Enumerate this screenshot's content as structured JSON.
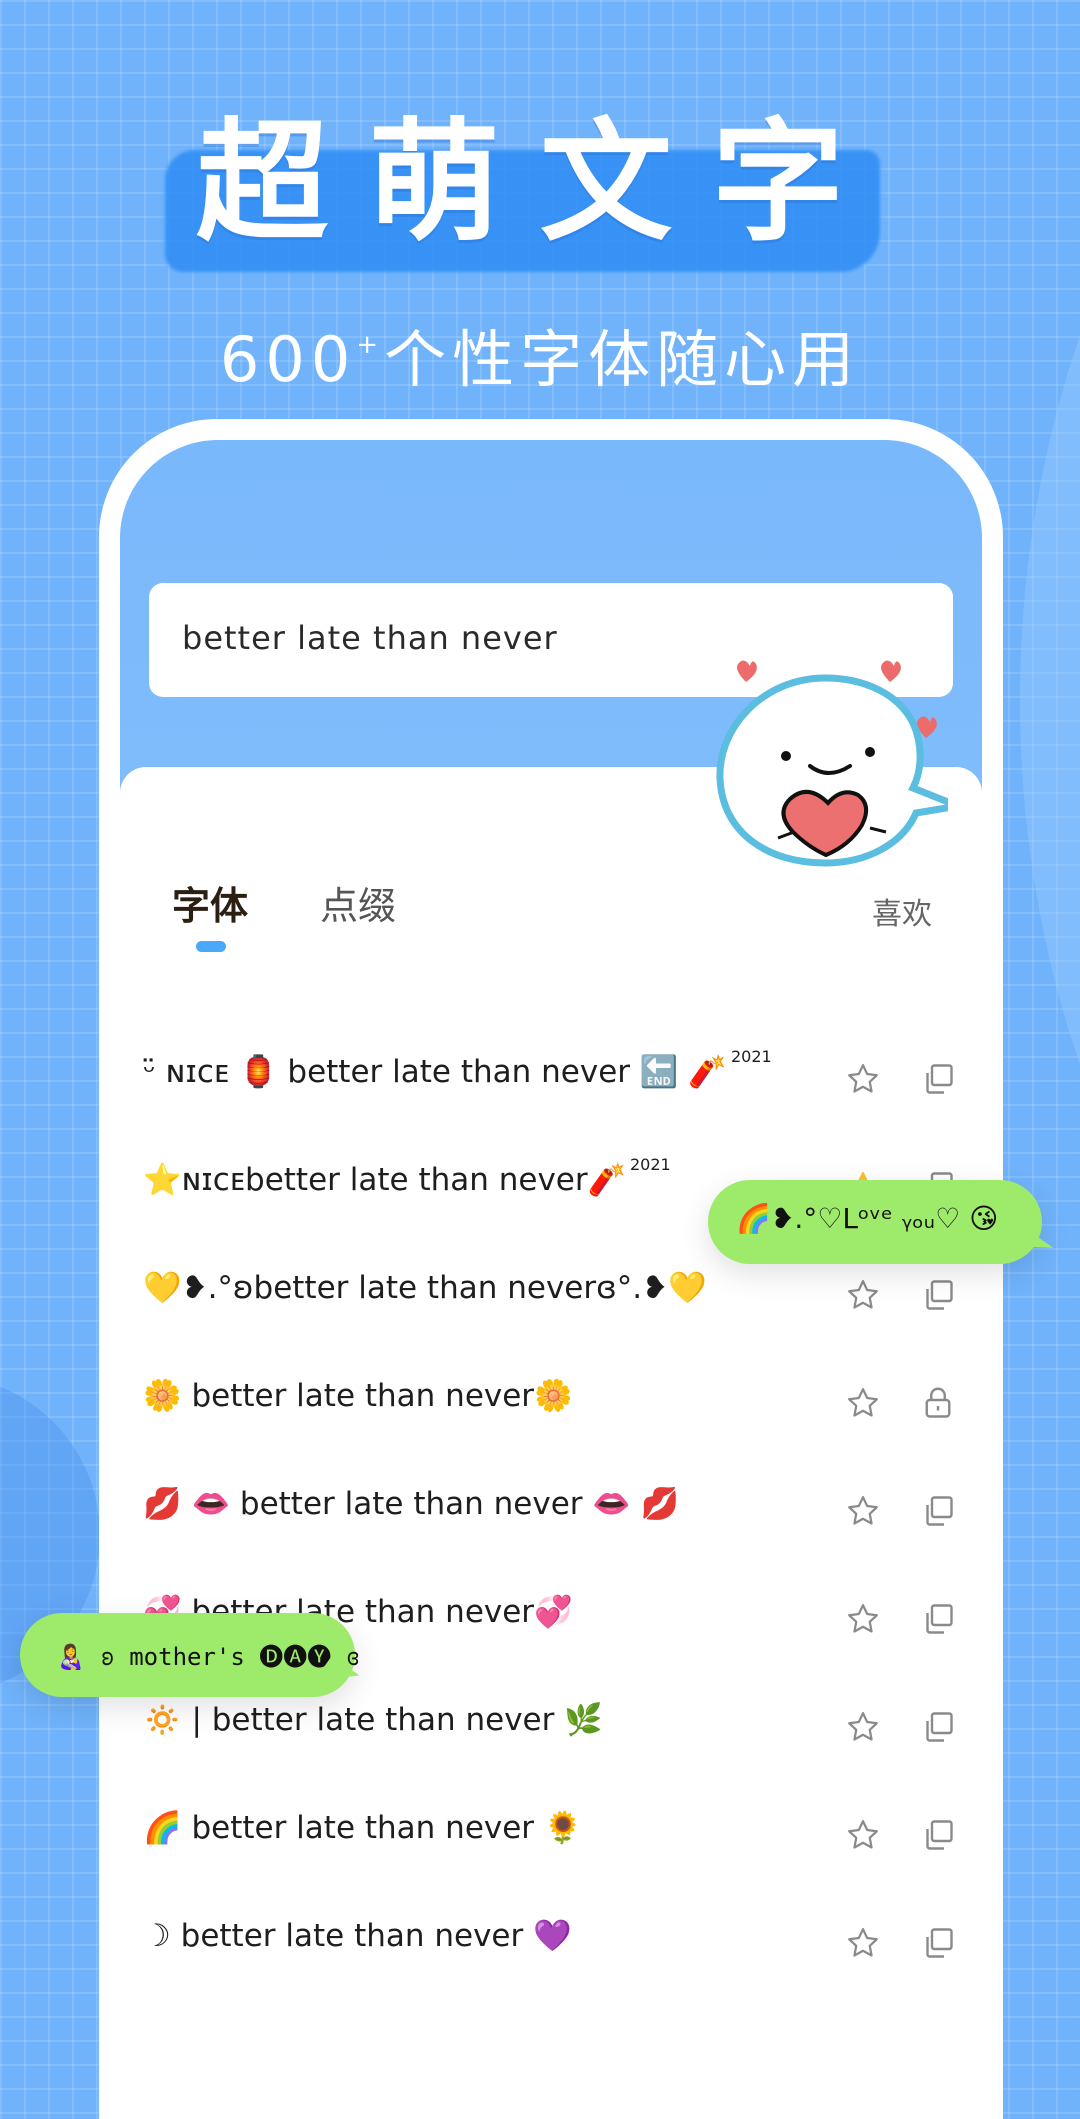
{
  "banner": {
    "title": "超萌文字",
    "subtitle_count": "600",
    "subtitle_plus": "+",
    "subtitle_text": "个性字体随心用"
  },
  "search": {
    "value": "better late than never"
  },
  "tabs": [
    {
      "label": "字体",
      "active": true
    },
    {
      "label": "点缀",
      "active": false
    },
    {
      "label": "喜欢",
      "active": false
    }
  ],
  "colors": {
    "background": "#70b3fb",
    "accent": "#4aa8f8",
    "favorite_star": "#fbc02d",
    "bubble_green": "#9eea6a",
    "mascot_border": "#5bbde0"
  },
  "font_list": [
    {
      "text": "ᵕ̈ ɴɪᴄᴇ 🏮 better late than never 🔚 🧨",
      "sup": "2021",
      "favorited": false,
      "action": "copy"
    },
    {
      "text": "⭐ɴɪᴄᴇbetter late than never🧨",
      "sup": "2021",
      "favorited": true,
      "action": "copy"
    },
    {
      "text": "💛❥.°ʚbetter late than neverɞ°.❥💛",
      "sup": "",
      "favorited": false,
      "action": "copy"
    },
    {
      "text": "🌼 better late than never🌼",
      "sup": "",
      "favorited": false,
      "action": "locked"
    },
    {
      "text": "💋 👄 better late than never 👄 💋",
      "sup": "",
      "favorited": false,
      "action": "copy"
    },
    {
      "text": "💞 better late than never💞",
      "sup": "",
      "favorited": false,
      "action": "copy"
    },
    {
      "text": "🔅 | better late than never 🌿",
      "sup": "",
      "favorited": false,
      "action": "copy"
    },
    {
      "text": "🌈 better late than never 🌻",
      "sup": "",
      "favorited": false,
      "action": "copy"
    },
    {
      "text": "☽ better late than never 💜",
      "sup": "",
      "favorited": false,
      "action": "copy"
    }
  ],
  "bubbles": {
    "love_you": "🌈❥.°♡Lᵒᵛᵉ ᵧₒᵤ♡ 😘",
    "mothers_day": "👩‍🍼 ʚ mother's 🅓🅐🅨 ɞ"
  }
}
